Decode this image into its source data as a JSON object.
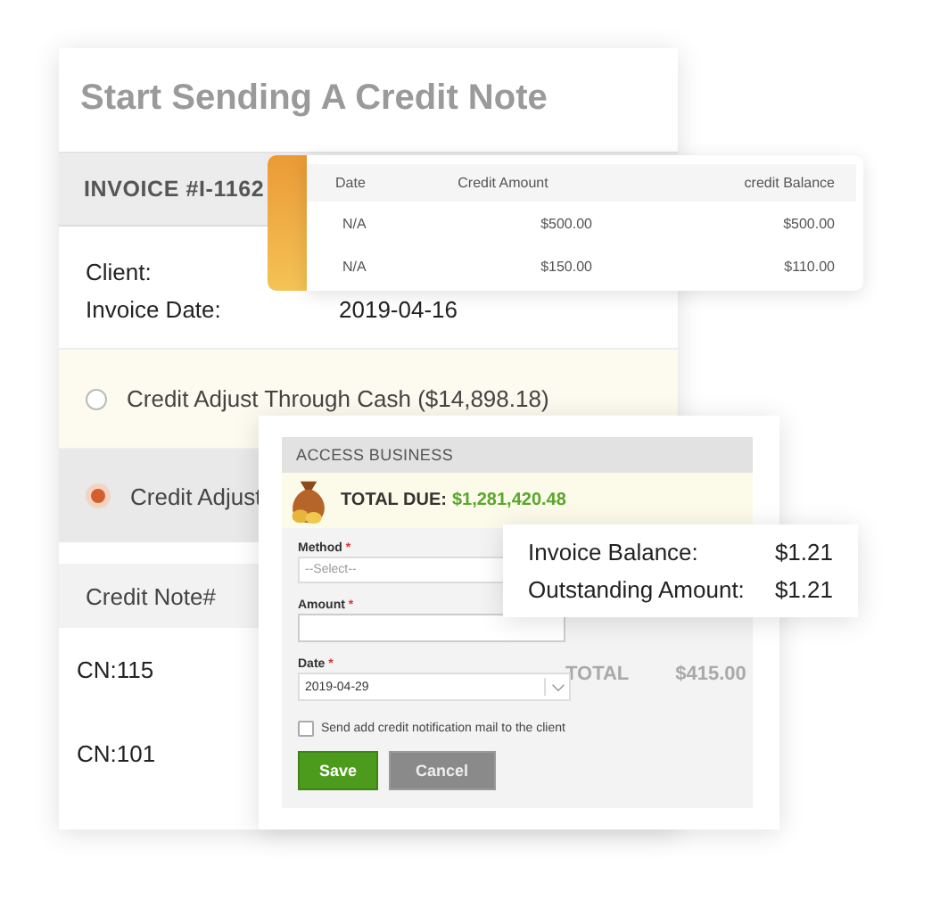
{
  "main": {
    "title": "Start Sending A Credit Note",
    "invoice": "INVOICE #I-1162",
    "fields": [
      {
        "label": "Client:"
      },
      {
        "label": "Invoice Date:",
        "value": "2019-04-16"
      }
    ],
    "options": [
      {
        "label": "Credit Adjust Through Cash ($14,898.18)",
        "selected": false
      },
      {
        "label": "Credit Adjust",
        "selected": true
      }
    ],
    "table": {
      "columns": [
        "Credit Note#"
      ],
      "rows": [
        [
          "CN:115"
        ],
        [
          "CN:101"
        ]
      ]
    }
  },
  "credits": {
    "columns": [
      "Date",
      "Credit Amount",
      "credit Balance"
    ],
    "rows": [
      [
        "N/A",
        "$500.00",
        "$500.00"
      ],
      [
        "N/A",
        "$150.00",
        "$110.00"
      ]
    ]
  },
  "payment": {
    "title": "ACCESS BUSINESS",
    "total_label": "TOTAL DUE:",
    "total_value": "$1,281,420.48",
    "fields": [
      {
        "label": "Method",
        "mark": "*",
        "kind": "select",
        "placeholder": "--Select--"
      },
      {
        "label": "Amount",
        "mark": "*",
        "kind": "input"
      },
      {
        "label": "Date",
        "mark": "*",
        "kind": "dropdown",
        "value": "2019-04-29"
      }
    ],
    "notify": {
      "label": "Send add credit notification mail to the client",
      "checked": false
    },
    "buttons": [
      {
        "label": "Save",
        "kind": "primary"
      },
      {
        "label": "Cancel",
        "kind": "secondary"
      }
    ],
    "background_total": {
      "label": "TOTAL",
      "value": "$415.00"
    }
  },
  "balance": [
    {
      "label": "Invoice Balance:",
      "value": "$1.21"
    },
    {
      "label": "Outstanding Amount:",
      "value": "$1.21"
    }
  ]
}
